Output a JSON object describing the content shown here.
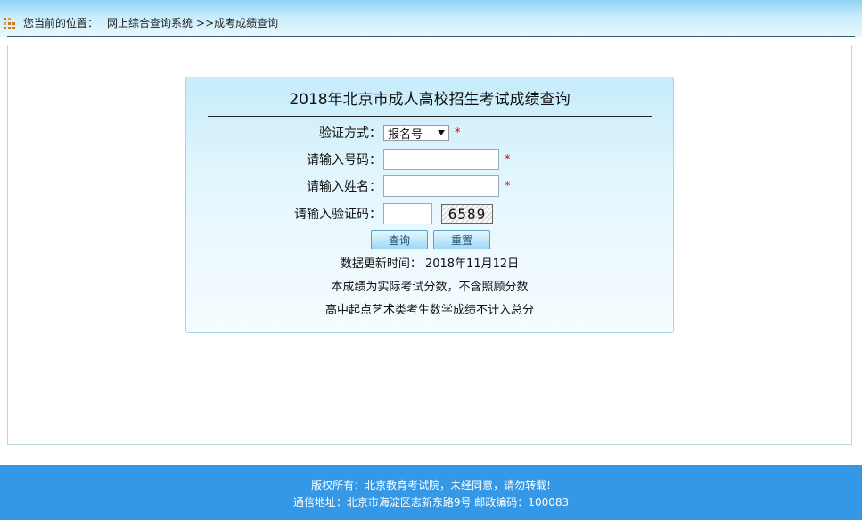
{
  "breadcrumb": {
    "prefix": "您当前的位置：",
    "section": "网上综合查询系统",
    "current": ">>成考成绩查询"
  },
  "form": {
    "title": "2018年北京市成人高校招生考试成绩查询",
    "method_label": "验证方式：",
    "method_selected": "报名号",
    "number_label": "请输入号码：",
    "number_value": "",
    "name_label": "请输入姓名：",
    "name_value": "",
    "captcha_label": "请输入验证码：",
    "captcha_value": "",
    "captcha_text": "6589",
    "required_mark": "*",
    "query_button": "查询",
    "reset_button": "重置"
  },
  "notes": {
    "updated": "数据更新时间： 2018年11月12日",
    "line1": "本成绩为实际考试分数，不含照顾分数",
    "line2": "高中起点艺术类考生数学成绩不计入总分"
  },
  "footer": {
    "copyright": "版权所有：北京教育考试院，未经同意，请勿转载!",
    "address": "通信地址：北京市海淀区志新东路9号 邮政编码：100083"
  },
  "colors": {
    "footer_bg": "#3498e6",
    "required": "#e00000",
    "icon": "#c77b1d"
  }
}
